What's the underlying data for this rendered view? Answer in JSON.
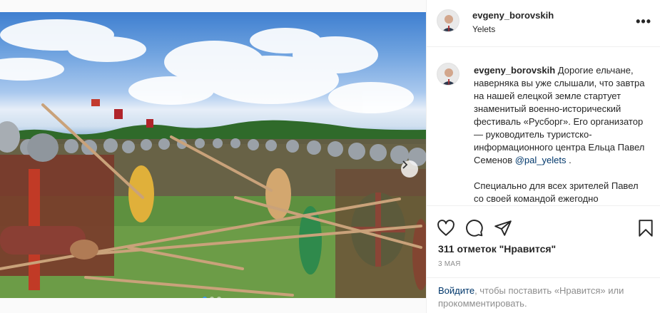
{
  "post": {
    "username": "evgeny_borovskih",
    "location": "Yelets",
    "more_label": "•••",
    "image_alt": "Военно-исторический фестиваль — строй воинов со щитами и копьями",
    "carousel": {
      "dots": 3,
      "active": 0
    }
  },
  "caption": {
    "username": "evgeny_borovskih",
    "text_before_mention": "Дорогие ельчане, наверняка вы уже слышали, что завтра на нашей елецкой земле стартует знаменитый военно-исторический фестиваль «Русборг». Его организатор — руководитель туристско-информационного центра Ельца Павел Семенов ",
    "mention": "@pal_yelets",
    "text_after_mention": " .",
    "paragraph2": "Специально для всех зрителей Павел со своей командой ежегодно"
  },
  "actions": {
    "likes": "311 отметок \"Нравится\"",
    "date": "3 МАЯ",
    "login_link": "Войдите",
    "login_text": ", чтобы поставить «Нравится» или прокомментировать."
  },
  "colors": {
    "link": "#00376b",
    "muted": "#8e8e8e",
    "carousel_active": "#3897f0"
  }
}
